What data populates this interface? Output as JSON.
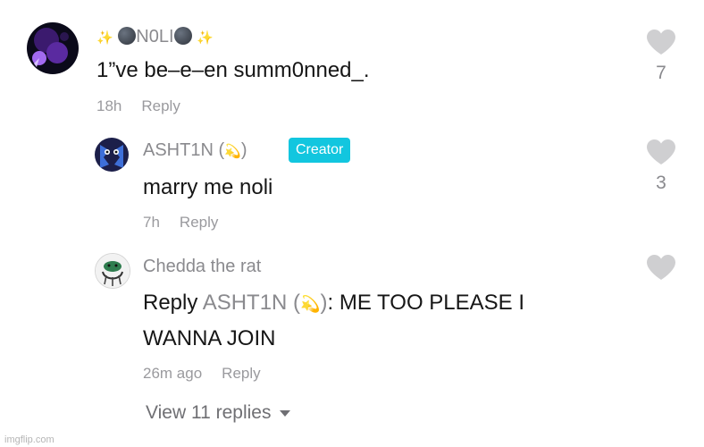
{
  "comments": [
    {
      "username": "N0LI",
      "text": "1”ve be–e–en summ0nned_.",
      "time": "18h",
      "reply_label": "Reply",
      "likes": "7"
    },
    {
      "username": "ASHT1N (",
      "username_end": ")",
      "badge": "Creator",
      "text": "marry me noli",
      "time": "7h",
      "reply_label": "Reply",
      "likes": "3"
    },
    {
      "username": "Chedda the rat",
      "reply_prefix": "Reply",
      "mention": "ASHT1N (",
      "mention_end": ")",
      "text_after_mention": ": ME TOO PLEASE I",
      "text_line2": "WANNA JOIN",
      "time": "26m ago",
      "reply_label": "Reply"
    }
  ],
  "view_replies": "View 11 replies",
  "watermark": "imgflip.com",
  "icons": [
    "heart-icon",
    "sparkles-icon",
    "moon-icon",
    "dizzy-icon",
    "caret-down-icon"
  ],
  "colors": {
    "badge": "#12c6df",
    "heart": "#cfcfd1"
  }
}
